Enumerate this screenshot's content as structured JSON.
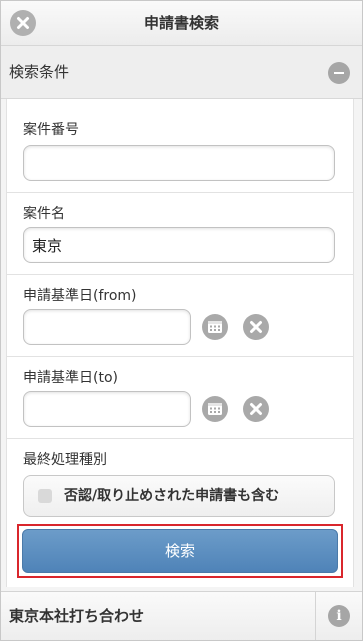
{
  "header": {
    "title": "申請書検索",
    "close_icon": "close-icon"
  },
  "section": {
    "title": "検索条件",
    "collapse_icon": "minus-icon"
  },
  "form": {
    "case_number": {
      "label": "案件番号",
      "value": ""
    },
    "case_name": {
      "label": "案件名",
      "value": "東京"
    },
    "date_from": {
      "label": "申請基準日(from)",
      "value": "",
      "calendar_icon": "calendar-icon",
      "clear_icon": "clear-icon"
    },
    "date_to": {
      "label": "申請基準日(to)",
      "value": "",
      "calendar_icon": "calendar-icon",
      "clear_icon": "clear-icon"
    },
    "final_type": {
      "label": "最終処理種別",
      "checkbox_label": "否認/取り止めされた申請書も含む",
      "checked": false
    },
    "search_label": "検索"
  },
  "footer": {
    "item_title": "東京本社打ち合わせ",
    "info_icon": "info-icon",
    "info_glyph": "i"
  },
  "colors": {
    "accent_button": "#5b8ec1",
    "highlight_outline": "#d9262c"
  }
}
